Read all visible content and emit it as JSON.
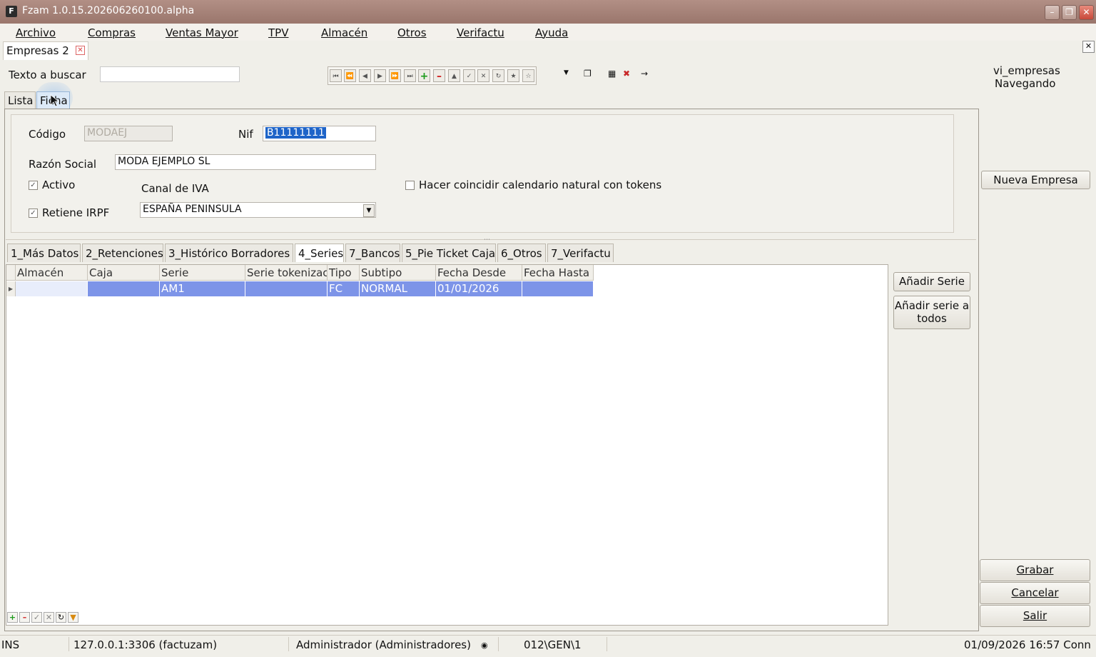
{
  "window": {
    "title": "Fzam 1.0.15.202606260100.alpha",
    "app_icon": "F"
  },
  "menu": [
    "Archivo",
    "Compras",
    "Ventas Mayor",
    "TPV",
    "Almacén",
    "Otros",
    "Verifactu",
    "Ayuda"
  ],
  "doc_tab": {
    "label": "Empresas 2"
  },
  "search": {
    "label": "Texto a buscar",
    "value": ""
  },
  "status_right": {
    "view": "vi_empresas",
    "mode": "Navegando"
  },
  "subtabs": [
    "Lista",
    "Ficha"
  ],
  "form": {
    "codigo_label": "Código",
    "codigo_value": "MODAEJ",
    "nif_label": "Nif",
    "nif_value": "B11111111",
    "razon_label": "Razón Social",
    "razon_value": "MODA EJEMPLO SL",
    "activo_label": "Activo",
    "activo_checked": true,
    "retiene_label": "Retiene IRPF",
    "retiene_checked": true,
    "canal_label": "Canal de IVA",
    "canal_value": "ESPAÑA PENINSULA",
    "hacer_label": "Hacer coincidir calendario natural con tokens",
    "hacer_checked": false
  },
  "detail_tabs": [
    "1_Más Datos",
    "2_Retenciones",
    "3_Histórico Borradores",
    "4_Series",
    "7_Bancos",
    "5_Pie Ticket Caja",
    "6_Otros",
    "7_Verifactu"
  ],
  "grid": {
    "columns": [
      "Almacén",
      "Caja",
      "Serie",
      "Serie tokenizac",
      "Tipo",
      "Subtipo",
      "Fecha Desde",
      "Fecha Hasta"
    ],
    "rows": [
      [
        "",
        "",
        "AM1",
        "",
        "FC",
        "NORMAL",
        "01/01/2026",
        ""
      ]
    ]
  },
  "buttons": {
    "nueva_empresa": "Nueva Empresa",
    "anadir_serie": "Añadir Serie",
    "anadir_todos_1": "Añadir serie a",
    "anadir_todos_2": "todos",
    "grabar": "Grabar",
    "cancelar": "Cancelar",
    "salir": "Salir"
  },
  "statusbar": {
    "mode": "INS",
    "db": "127.0.0.1:3306 (factuzam)",
    "user": "Administrador (Administradores)",
    "path": "012\\GEN\\1",
    "datetime": "01/09/2026 16:57 Conn"
  }
}
